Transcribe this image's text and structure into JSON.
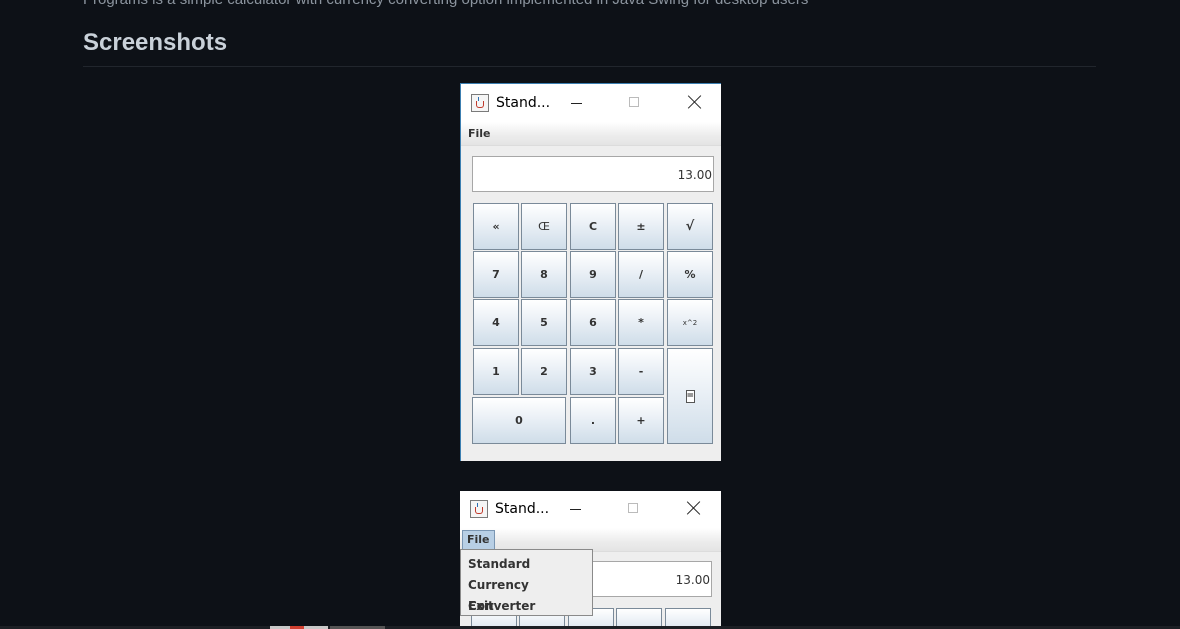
{
  "page": {
    "top_text": "Programs is a simple calculator with currency converting option implemented in Java Swing for desktop users",
    "heading": "Screenshots"
  },
  "window1": {
    "title": "Stand...",
    "menu_file": "File",
    "display_value": "13.00",
    "buttons": {
      "back": "«",
      "ce": "Œ",
      "c": "C",
      "plusminus": "±",
      "sqrt": "√",
      "seven": "7",
      "eight": "8",
      "nine": "9",
      "divide": "/",
      "percent": "%",
      "four": "4",
      "five": "5",
      "six": "6",
      "multiply": "*",
      "square": "x^2",
      "one": "1",
      "two": "2",
      "three": "3",
      "minus": "-",
      "equals": "=",
      "zero": "0",
      "dot": ".",
      "plus": "+"
    }
  },
  "window2": {
    "title": "Stand...",
    "menu_file": "File",
    "display_value": "13.00",
    "menu_items": [
      "Standard",
      "Currency Converter",
      "Exit"
    ]
  },
  "icons": {
    "app": "java-cup-icon",
    "minimize": "minimize-icon",
    "maximize": "maximize-icon",
    "close": "close-icon"
  }
}
